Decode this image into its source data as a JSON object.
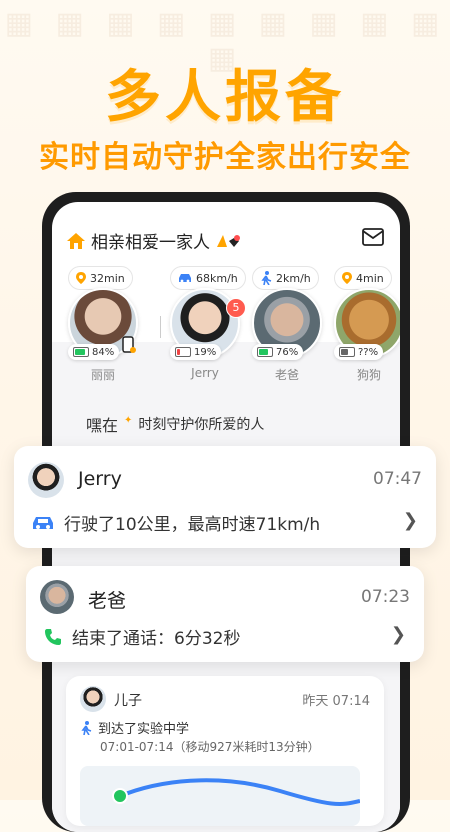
{
  "hero": {
    "title": "多人报备",
    "subtitle": "实时自动守护全家出行安全"
  },
  "group": {
    "name": "相亲相爱一家人"
  },
  "members": [
    {
      "name": "丽丽",
      "status": "32min",
      "status_icon": "location-pin-icon",
      "battery": "84%",
      "battery_level": 0.84,
      "battery_color": "#22c55e",
      "badge": ""
    },
    {
      "name": "Jerry",
      "status": "68km/h",
      "status_icon": "car-icon",
      "battery": "19%",
      "battery_level": 0.19,
      "battery_color": "#ef4444",
      "badge": "5"
    },
    {
      "name": "老爸",
      "status": "2km/h",
      "status_icon": "walking-icon",
      "battery": "76%",
      "battery_level": 0.76,
      "battery_color": "#22c55e",
      "badge": ""
    },
    {
      "name": "狗狗",
      "status": "4min",
      "status_icon": "location-pin-icon",
      "battery": "??%",
      "battery_level": 0.6,
      "battery_color": "#666666",
      "badge": ""
    }
  ],
  "slogan": {
    "lead": "嘿在",
    "text": "时刻守护你所爱的人"
  },
  "events": [
    {
      "name": "Jerry",
      "time": "07:47",
      "detail": "行驶了10公里，最高时速71km/h",
      "icon": "car-icon"
    },
    {
      "name": "老爸",
      "time": "07:23",
      "detail": "结束了通话：6分32秒",
      "icon": "phone-icon"
    }
  ],
  "feed_item": {
    "name": "儿子",
    "when": "昨天 07:14",
    "action": "到达了实验中学",
    "range": "07:01-07:14（移动927米耗时13分钟）"
  },
  "colors": {
    "accent": "#ffa400",
    "blue": "#3b82f6",
    "green": "#22c55e",
    "red": "#ff5b4f"
  }
}
